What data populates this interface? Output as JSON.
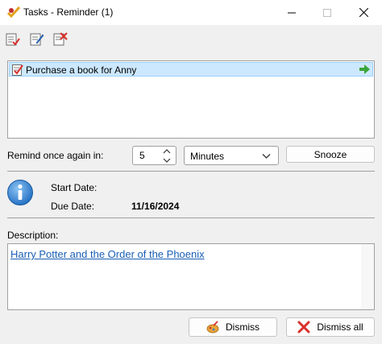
{
  "window": {
    "title": "Tasks - Reminder (1)",
    "controls": [
      "minimize-icon",
      "maximize-icon",
      "close-icon"
    ]
  },
  "toolbar": {
    "buttons": [
      {
        "icon": "mark-complete-icon"
      },
      {
        "icon": "edit-task-icon"
      },
      {
        "icon": "delete-task-icon"
      }
    ]
  },
  "tasks": [
    {
      "label": "Purchase a book for Anny",
      "icon": "task-checklist-icon",
      "action_icon": "go-arrow-icon"
    }
  ],
  "remind": {
    "label": "Remind once again in:",
    "value": "5",
    "unit": "Minutes",
    "snooze_label": "Snooze"
  },
  "details": {
    "icon": "info-icon",
    "start_label": "Start Date:",
    "start_value": "",
    "due_label": "Due Date:",
    "due_value": "11/16/2024"
  },
  "description": {
    "label": "Description:",
    "link_text": "Harry Potter and the Order of the Phoenix"
  },
  "buttons": {
    "dismiss_label": "Dismiss",
    "dismiss_all_label": "Dismiss all"
  },
  "colors": {
    "selection": "#cce8ff",
    "link": "#1a5fb4",
    "info_blue": "#2a7fd4",
    "arrow_green": "#3aa53a",
    "red_x": "#d9302c"
  }
}
